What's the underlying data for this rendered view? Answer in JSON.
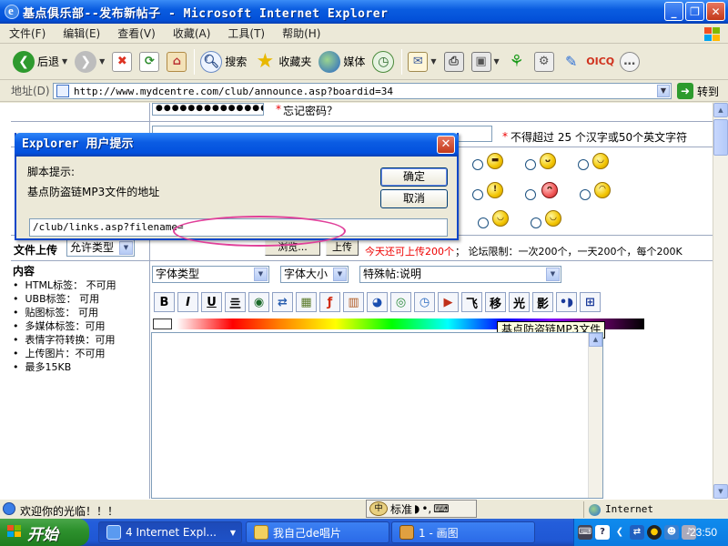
{
  "window": {
    "title": "基点俱乐部--发布新帖子 - Microsoft Internet Explorer",
    "controls": [
      "_",
      "❐",
      "✕"
    ]
  },
  "menu": [
    "文件(F)",
    "编辑(E)",
    "查看(V)",
    "收藏(A)",
    "工具(T)",
    "帮助(H)"
  ],
  "toolbar": {
    "back": "后退",
    "search": "搜索",
    "favorites": "收藏夹",
    "media": "媒体"
  },
  "address": {
    "label": "地址(D)",
    "url": "http://www.mydcentre.com/club/announce.asp?boardid=34",
    "go": "转到"
  },
  "form": {
    "password_mask": "●●●●●●●●●●●●●●●●●●●●",
    "forgot_password": "忘记密码？",
    "title_limit": "不得超过 25 个汉字或50个英文字符",
    "upload_label": "文件上传",
    "upload_type": "允许类型",
    "browse": "浏览...",
    "upload_btn": "上传",
    "upload_remaining": "今天还可上传200个",
    "upload_limits": "；  论坛限制：一次200个，一天200个，每个200K",
    "font_type": "字体类型",
    "font_size": "字体大小",
    "special_post": "特殊帖:说明",
    "format_buttons": [
      "B",
      "I",
      "U",
      "亖",
      "◉",
      "⇄",
      "▦",
      "ƒ",
      "▥",
      "◕",
      "◎",
      "◷",
      "▶",
      "飞",
      "移",
      "光",
      "影",
      "•◗",
      "⊞"
    ],
    "content_header": "内容",
    "rules": [
      "HTML标签： 不可用",
      "UBB标签： 可用",
      "贴图标签： 可用",
      "多媒体标签：可用",
      "表情字符转换：可用",
      "上传图片：不可用",
      "最多15KB"
    ],
    "tooltip": "基点防盗链MP3文件"
  },
  "dialog": {
    "title": "Explorer 用户提示",
    "script_prompt": "脚本提示:",
    "message": "基点防盗链MP3文件的地址",
    "ok": "确定",
    "cancel": "取消",
    "input_value": "/club/links.asp?filename="
  },
  "status": {
    "text": "欢迎你的光临！！！",
    "ime_mode": "标准",
    "zone": "Internet"
  },
  "taskbar": {
    "start": "开始",
    "tasks": [
      "4 Internet Expl...",
      "我自己de唱片",
      "1 - 画图"
    ],
    "clock": "23:50"
  }
}
